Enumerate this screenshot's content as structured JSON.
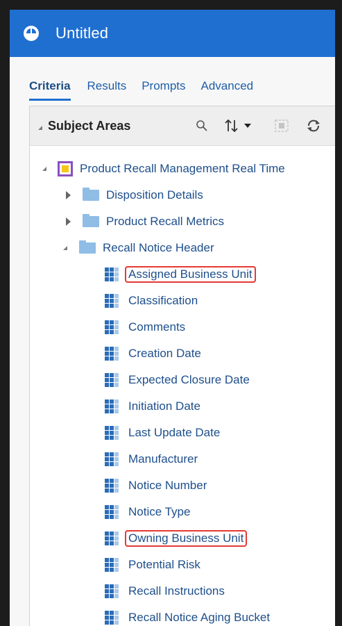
{
  "window": {
    "title": "Untitled"
  },
  "tabs": [
    {
      "label": "Criteria",
      "active": true
    },
    {
      "label": "Results",
      "active": false
    },
    {
      "label": "Prompts",
      "active": false
    },
    {
      "label": "Advanced",
      "active": false
    }
  ],
  "panel": {
    "title": "Subject Areas",
    "tools": [
      "search-icon",
      "sort-icon",
      "dropdown-icon",
      "select-icon",
      "refresh-icon"
    ]
  },
  "tree": {
    "root": "Product Recall Management Real Time",
    "folders": [
      {
        "label": "Disposition Details",
        "expanded": false
      },
      {
        "label": "Product Recall Metrics",
        "expanded": false
      },
      {
        "label": "Recall Notice Header",
        "expanded": true
      }
    ],
    "columns": [
      {
        "label": "Assigned Business Unit",
        "highlighted": true
      },
      {
        "label": "Classification",
        "highlighted": false
      },
      {
        "label": "Comments",
        "highlighted": false
      },
      {
        "label": "Creation Date",
        "highlighted": false
      },
      {
        "label": "Expected Closure Date",
        "highlighted": false
      },
      {
        "label": "Initiation Date",
        "highlighted": false
      },
      {
        "label": "Last Update Date",
        "highlighted": false
      },
      {
        "label": "Manufacturer",
        "highlighted": false
      },
      {
        "label": "Notice Number",
        "highlighted": false
      },
      {
        "label": "Notice Type",
        "highlighted": false
      },
      {
        "label": "Owning Business Unit",
        "highlighted": true
      },
      {
        "label": "Potential Risk",
        "highlighted": false
      },
      {
        "label": "Recall Instructions",
        "highlighted": false
      },
      {
        "label": "Recall Notice Aging Bucket",
        "highlighted": false
      }
    ]
  },
  "colors": {
    "titlebar": "#1f6fd0",
    "link": "#1e4f8c",
    "highlight": "#e53935"
  }
}
